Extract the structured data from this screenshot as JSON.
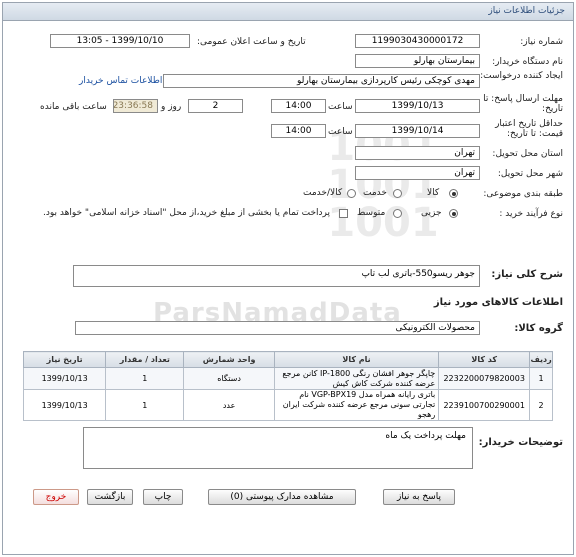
{
  "header": {
    "title": "جزئیات اطلاعات نیاز"
  },
  "form": {
    "need_number_label": "شماره نیاز:",
    "need_number": "1199030430000172",
    "announce_label": "تاریخ و ساعت اعلان عمومی:",
    "announce_value": "1399/10/10 - 13:05",
    "buyer_org_label": "نام دستگاه خریدار:",
    "buyer_org": "بیمارستان بهارلو",
    "creator_label": "ایجاد کننده درخواست:",
    "creator": "مهدی کوچکی  رئیس کارپردازی بیمارستان بهارلو",
    "contact_link": "اطلاعات تماس خریدار",
    "reply_deadline_label": "مهلت ارسال پاسخ: تا تاریخ:",
    "reply_date": "1399/10/13",
    "time_label": "ساعت",
    "reply_time": "14:00",
    "days_value": "2",
    "days_label": "روز و",
    "remaining_time": "23:36:58",
    "remaining_label": "ساعت باقی مانده",
    "price_validity_label": "حداقل تاریخ اعتبار قیمت: تا تاریخ:",
    "validity_date": "1399/10/14",
    "validity_time_label": "ساعت",
    "validity_time": "14:00",
    "province_label": "استان محل تحویل:",
    "province": "تهران",
    "city_label": "شهر محل تحویل:",
    "city": "تهران",
    "category_label": "طبقه بندی موضوعی:",
    "category_options": [
      "کالا",
      "خدمت",
      "کالا/خدمت"
    ],
    "process_label": "نوع فرآیند خرید :",
    "process_options": [
      "جزیی",
      "متوسط"
    ],
    "payment_note": "پرداخت تمام یا بخشی از مبلغ خرید،از محل \"اسناد خزانه اسلامی\" خواهد بود."
  },
  "summary": {
    "label": "شرح کلی نیاز:",
    "value": "جوهر ریسو550-باتری لب تاپ"
  },
  "goods": {
    "section_title": "اطلاعات کالاهای مورد نیاز",
    "group_label": "گروه کالا:",
    "group_value": "محصولات الکترونیکی",
    "columns": [
      "ردیف",
      "کد کالا",
      "نام کالا",
      "واحد شمارش",
      "تعداد / مقدار",
      "تاریخ نیاز"
    ],
    "rows": [
      {
        "row": "1",
        "code": "2232200079820003",
        "name": "چاپگر جوهر افشان رنگی IP-1800 کانن مرجع عرضه کننده شرکت کاش کیش",
        "unit": "دستگاه",
        "qty": "1",
        "date": "1399/10/13"
      },
      {
        "row": "2",
        "code": "2239100700290001",
        "name": "باتری رایانه همراه مدل VGP-BPX19 نام تجارتی سونی مرجع عرضه کننده شرکت ایران رهجو",
        "unit": "عدد",
        "qty": "1",
        "date": "1399/10/13"
      }
    ]
  },
  "notes": {
    "label": "توضیحات خریدار:",
    "value": "مهلت پرداخت یک ماه"
  },
  "buttons": {
    "reply": "پاسخ به نیاز",
    "attachments": "مشاهده مدارک پیوستی (0)",
    "print": "چاپ",
    "back": "بازگشت",
    "exit": "خروج"
  },
  "watermark": "ParsNamadData"
}
